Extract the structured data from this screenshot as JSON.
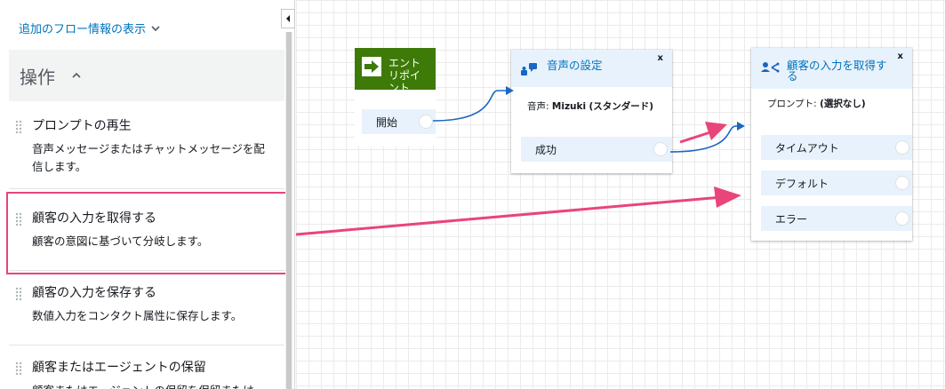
{
  "panel": {
    "flow_info_label": "追加のフロー情報の表示",
    "section_title": "操作",
    "blocks": [
      {
        "title": "プロンプトの再生",
        "desc_line1": "音声メッセージまたはチャットメッセージを配",
        "desc_line2": "信します。"
      },
      {
        "title": "顧客の入力を取得する",
        "desc": "顧客の意図に基づいて分岐します。"
      },
      {
        "title": "顧客の入力を保存する",
        "desc": "数値入力をコンタクト属性に保存します。"
      },
      {
        "title": "顧客またはエージェントの保留",
        "desc": "顧客またはエージェントの保留を保留または"
      }
    ]
  },
  "canvas": {
    "entry": {
      "title": "エントリポイント",
      "branch": "開始"
    },
    "voice_node": {
      "title": "音声の設定",
      "close": "x",
      "sub_label": "音声:",
      "sub_value": "Mizuki",
      "sub_paren": "(スタンダード)",
      "branch": "成功"
    },
    "input_node": {
      "title_line1": "顧客の入力を取得す",
      "title_line2": "る",
      "close": "x",
      "prompt_label": "プロンプト:",
      "prompt_value": "(選択なし)",
      "branches": [
        "タイムアウト",
        "デフォルト",
        "エラー"
      ]
    }
  },
  "colors": {
    "accent": "#0073bb",
    "entry_green": "#3d7a07",
    "annotation": "#e8457a",
    "connector": "#1a66c2"
  }
}
